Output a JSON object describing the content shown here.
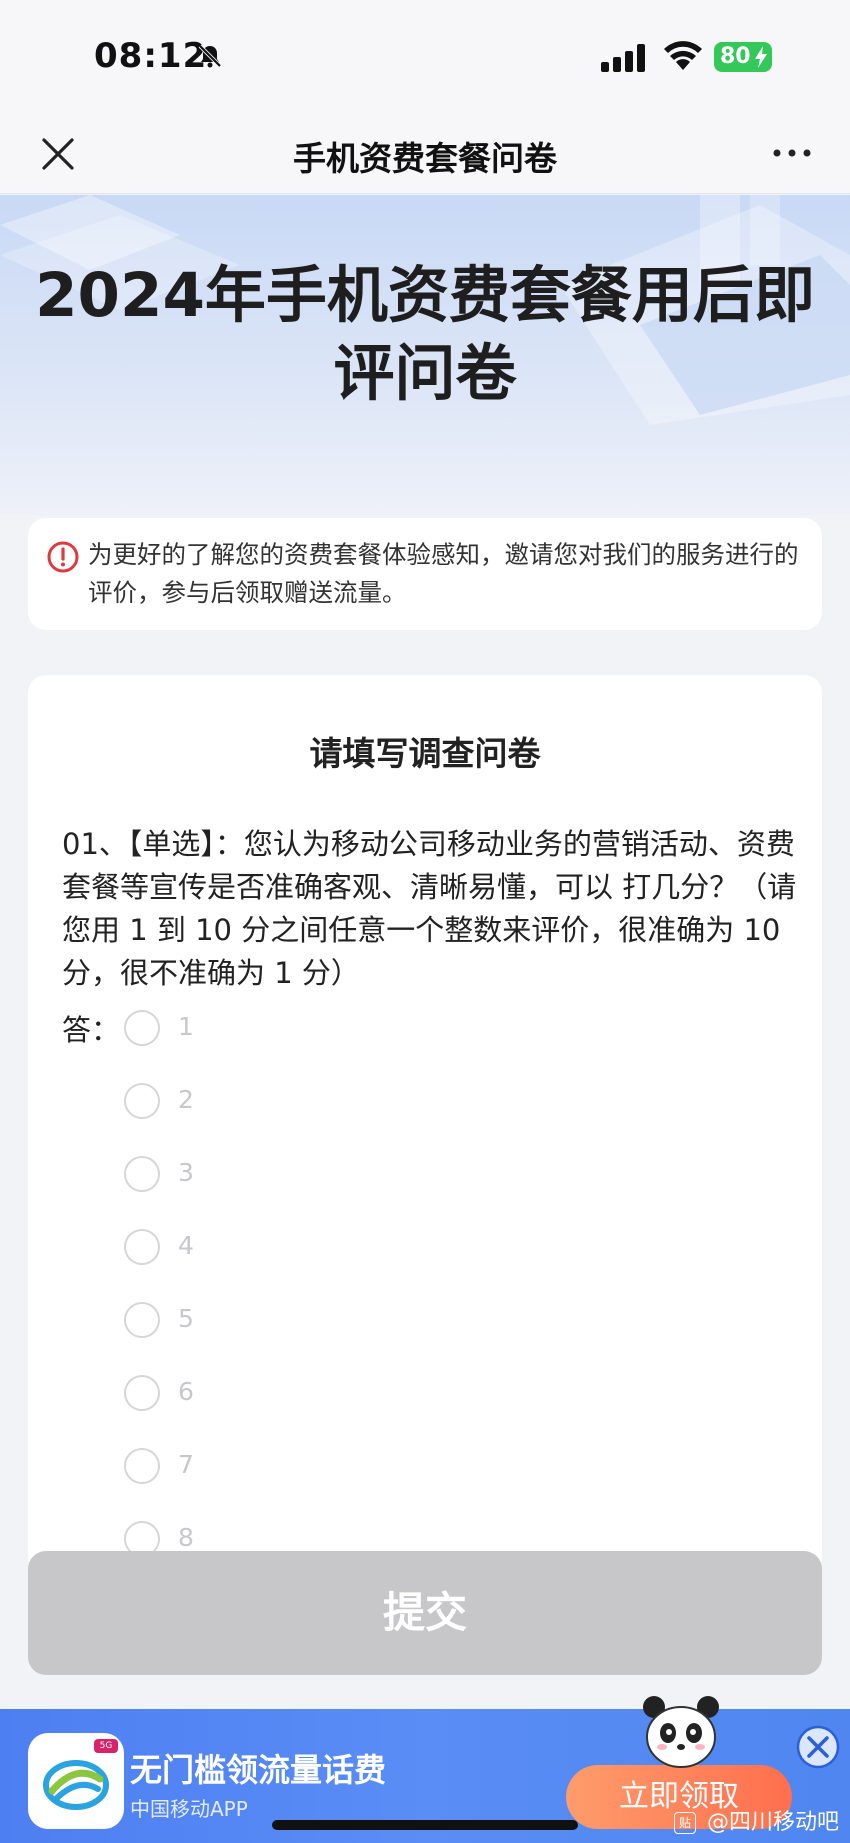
{
  "status_bar": {
    "time": "08:12",
    "battery": "80"
  },
  "nav": {
    "title": "手机资费套餐问卷"
  },
  "hero": {
    "title": "2024年手机资费套餐用后即评问卷"
  },
  "notice": {
    "text": "为更好的了解您的资费套餐体验感知，邀请您对我们的服务进行的评价，参与后领取赠送流量。"
  },
  "survey": {
    "title": "请填写调查问卷",
    "question": "01、【单选】：您认为移动公司移动业务的营销活动、资费套餐等宣传是否准确客观、清晰易懂，可以 打几分？（请您用 1 到 10 分之间任意一个整数来评价，很准确为 10 分，很不准确为 1 分）",
    "answer_label": "答：",
    "options": [
      "1",
      "2",
      "3",
      "4",
      "5",
      "6",
      "7",
      "8"
    ],
    "selected": null
  },
  "submit": {
    "label": "提交"
  },
  "banner": {
    "title": "无门槛领流量话费",
    "subtitle": "中国移动APP",
    "cta": "立即领取",
    "icon_tag": "5G"
  },
  "watermark": {
    "box": "贴",
    "text": "@四川移动吧"
  },
  "colors": {
    "accent_blue": "#4d7ff2",
    "cta_orange": "#ff6f4d",
    "submit_disabled": "#c7c7c9",
    "notice_red": "#e0393e",
    "battery_green": "#34c759"
  },
  "icons": {
    "bell": "bell-slash-icon",
    "close": "close-icon",
    "more": "more-icon",
    "notice": "alert-circle-icon"
  }
}
